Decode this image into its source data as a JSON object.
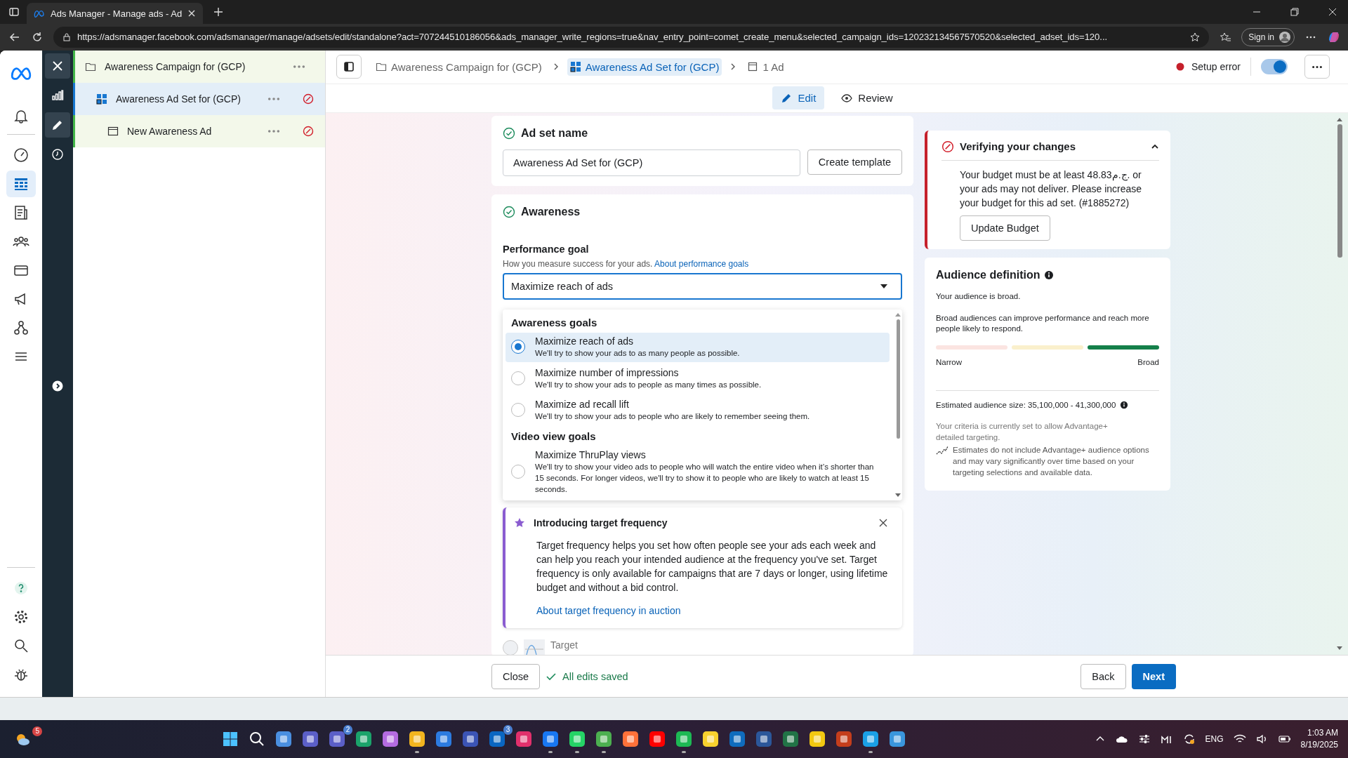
{
  "browser": {
    "tab_title": "Ads Manager - Manage ads - Ad",
    "url": "https://adsmanager.facebook.com/adsmanager/manage/adsets/edit/standalone?act=707244510186056&ads_manager_write_regions=true&nav_entry_point=comet_create_menu&selected_campaign_ids=120232134567570520&selected_adset_ids=120...",
    "sign_in": "Sign in"
  },
  "nav_rail": {
    "top": [
      {
        "kind": "bell",
        "selected": false
      },
      {
        "kind": "gauge",
        "selected": false
      },
      {
        "kind": "table",
        "selected": true
      },
      {
        "kind": "pages",
        "selected": false
      },
      {
        "kind": "people",
        "selected": false
      },
      {
        "kind": "card",
        "selected": false
      },
      {
        "kind": "megaphone",
        "selected": false
      },
      {
        "kind": "network",
        "selected": false
      },
      {
        "kind": "menu",
        "selected": false
      }
    ],
    "bottom": [
      {
        "kind": "help",
        "selected": false
      },
      {
        "kind": "gear",
        "selected": false
      },
      {
        "kind": "search",
        "selected": false
      },
      {
        "kind": "bug",
        "selected": false
      }
    ]
  },
  "tool_rail": [
    {
      "kind": "close",
      "selected": true
    },
    {
      "kind": "chart",
      "selected": false
    },
    {
      "kind": "edit",
      "selected": true
    },
    {
      "kind": "clock",
      "selected": false
    }
  ],
  "tree": [
    {
      "label": "Awareness Campaign for (GCP)",
      "kind": "campaign",
      "selected": false,
      "error": false,
      "children": [
        {
          "label": "Awareness Ad Set for (GCP)",
          "kind": "adset",
          "selected": true,
          "error": true,
          "children": [
            {
              "label": "New Awareness Ad",
              "kind": "ad",
              "selected": false,
              "error": true
            }
          ]
        }
      ]
    }
  ],
  "breadcrumbs": [
    {
      "label": "Awareness Campaign for (GCP)",
      "kind": "campaign",
      "selected": false
    },
    {
      "label": "Awareness Ad Set for (GCP)",
      "kind": "adset",
      "selected": true
    },
    {
      "label": "1 Ad",
      "kind": "ad",
      "selected": false
    }
  ],
  "status": {
    "label": "Setup error",
    "toggle_on": true
  },
  "mode_tabs": [
    {
      "label": "Edit",
      "kind": "edit",
      "selected": true
    },
    {
      "label": "Review",
      "kind": "review",
      "selected": false
    }
  ],
  "ad_set_name": {
    "title": "Ad set name",
    "value": "Awareness Ad Set for (GCP)",
    "button": "Create template"
  },
  "awareness": {
    "title": "Awareness",
    "goal_label": "Performance goal",
    "goal_hint": "How you measure success for your ads.",
    "goal_link": "About performance goals",
    "goal_value": "Maximize reach of ads",
    "groups": [
      {
        "title": "Awareness goals",
        "options": [
          {
            "title": "Maximize reach of ads",
            "description": "We'll try to show your ads to as many people as possible.",
            "selected": true
          },
          {
            "title": "Maximize number of impressions",
            "description": "We'll try to show your ads to people as many times as possible.",
            "selected": false
          },
          {
            "title": "Maximize ad recall lift",
            "description": "We'll try to show your ads to people who are likely to remember seeing them.",
            "selected": false
          }
        ]
      },
      {
        "title": "Video view goals",
        "options": [
          {
            "title": "Maximize ThruPlay views",
            "description": "We'll try to show your video ads to people who will watch the entire video when it’s shorter than 15 seconds. For longer videos, we'll try to show it to people who are likely to watch at least 15 seconds.",
            "selected": false
          }
        ]
      }
    ]
  },
  "banner": {
    "title": "Introducing target frequency",
    "body": "Target frequency helps you set how often people see your ads each week and can help you reach your intended audience at the frequency you've set. Target frequency is only available for campaigns that are 7 days or longer, using lifetime budget and without a bid control.",
    "link": "About target frequency in auction"
  },
  "partial_option": {
    "label": "Target",
    "selected": false
  },
  "footer": {
    "close": "Close",
    "saved": "All edits saved",
    "back": "Back",
    "next": "Next"
  },
  "verify": {
    "title": "Verifying your changes",
    "message": "Your budget must be at least 48.83ج.م. or your ads may not deliver. Please increase your budget for this ad set. (#1885272)",
    "button": "Update Budget"
  },
  "audience": {
    "title": "Audience definition",
    "summary": "Your audience is broad.",
    "description": "Broad audiences can improve performance and reach more people likely to respond.",
    "segments": [
      {
        "color": "#fbe4e1"
      },
      {
        "color": "#faf0cc"
      },
      {
        "color": "#14804a"
      }
    ],
    "narrow": "Narrow",
    "broad": "Broad",
    "estimate": "Estimated audience size: 35,100,000 - 41,300,000",
    "criteria": "Your criteria is currently set to allow Advantage+ detailed targeting.",
    "note": "Estimates do not include Advantage+ audience options and may vary significantly over time based on your targeting selections and available data."
  },
  "taskbar": {
    "weather_badge": "5",
    "apps": [
      {
        "color": "#4a8fe0",
        "running": false
      },
      {
        "color": "#5b5fc7",
        "running": false
      },
      {
        "color": "#5b5fc7",
        "running": false,
        "badge": "2"
      },
      {
        "color": "#1ba36b",
        "running": false
      },
      {
        "color": "#b46be0",
        "running": false
      },
      {
        "color": "#f2b51f",
        "running": true
      },
      {
        "color": "#2c7be0",
        "running": false
      },
      {
        "color": "#3b54b5",
        "running": false
      },
      {
        "color": "#0a66c2",
        "running": false,
        "badge": "3"
      },
      {
        "color": "#e1306c",
        "running": false
      },
      {
        "color": "#1877f2",
        "running": true
      },
      {
        "color": "#25d366",
        "running": true
      },
      {
        "color": "#4caf50",
        "running": true
      },
      {
        "color": "#ff7139",
        "running": false
      },
      {
        "color": "#ff0000",
        "running": false
      },
      {
        "color": "#1db954",
        "running": true
      },
      {
        "color": "#f7d12e",
        "running": false
      },
      {
        "color": "#0f6cbd",
        "running": false
      },
      {
        "color": "#2b579a",
        "running": false
      },
      {
        "color": "#217346",
        "running": false
      },
      {
        "color": "#f2c811",
        "running": false
      },
      {
        "color": "#c43e1c",
        "running": false
      },
      {
        "color": "#1aa0e6",
        "running": true
      },
      {
        "color": "#3a96dd",
        "running": false
      }
    ],
    "language": "ENG",
    "time": "1:03 AM",
    "date": "8/19/2025"
  }
}
